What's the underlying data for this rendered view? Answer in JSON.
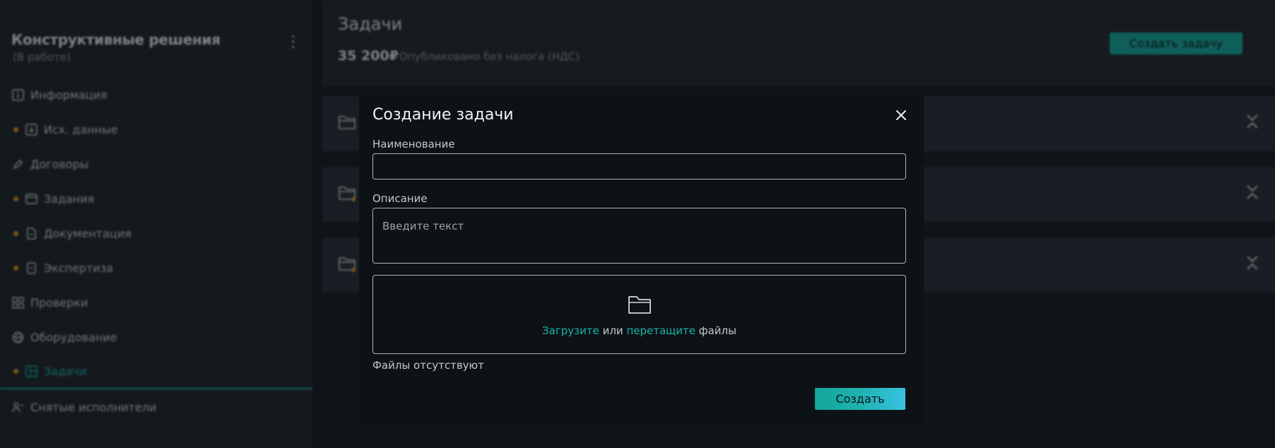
{
  "sidebar": {
    "project_title": "Конструктивные решения",
    "project_status": "(В работе)",
    "items": [
      {
        "label": "Информация",
        "icon": "info-icon",
        "dot": false
      },
      {
        "label": "Исх. данные",
        "icon": "download-box-icon",
        "dot": true
      },
      {
        "label": "Договоры",
        "icon": "pen-icon",
        "dot": false
      },
      {
        "label": "Задания",
        "icon": "window-icon",
        "dot": true
      },
      {
        "label": "Документация",
        "icon": "document-icon",
        "dot": true
      },
      {
        "label": "Экспертиза",
        "icon": "checklist-icon",
        "dot": true
      },
      {
        "label": "Проверки",
        "icon": "grid-icon",
        "dot": false
      },
      {
        "label": "Оборудование",
        "icon": "globe-icon",
        "dot": false
      },
      {
        "label": "Задачи",
        "icon": "board-icon",
        "dot": true,
        "active": true
      },
      {
        "label": "Снятые исполнители",
        "icon": "user-remove-icon",
        "dot": false
      }
    ]
  },
  "header": {
    "title": "Задачи",
    "price": "35 200₽",
    "price_note": "Опубликовано без налога (НДС)",
    "create_button": "Создать задачу"
  },
  "modal": {
    "title": "Создание задачи",
    "name_label": "Наименование",
    "name_value": "",
    "description_label": "Описание",
    "description_placeholder": "Введите текст",
    "upload_link": "Загрузите",
    "upload_or": " или ",
    "drag_link": "перетащите",
    "files_word": " файлы",
    "files_empty": "Файлы отсутствуют",
    "submit": "Создать"
  },
  "colors": {
    "accent": "#17a79b",
    "warning_dot": "#d39a1f",
    "modal_bg": "#0d1217"
  }
}
